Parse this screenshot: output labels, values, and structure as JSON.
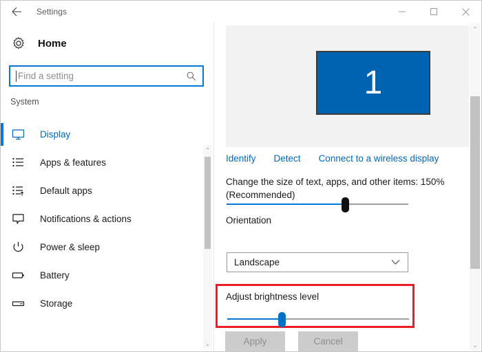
{
  "titlebar": {
    "back_icon": "back-arrow-icon",
    "title": "Settings",
    "minimize_label": "—",
    "maximize_label": "□",
    "close_label": "✕"
  },
  "sidebar": {
    "home_icon": "gear-icon",
    "home_label": "Home",
    "search": {
      "placeholder": "Find a setting",
      "value": "",
      "icon": "search-icon"
    },
    "group_label": "System",
    "items": [
      {
        "label": "Display",
        "icon": "monitor-icon",
        "selected": true
      },
      {
        "label": "Apps & features",
        "icon": "list-icon",
        "selected": false
      },
      {
        "label": "Default apps",
        "icon": "list-arrow-icon",
        "selected": false
      },
      {
        "label": "Notifications & actions",
        "icon": "speech-bubble-icon",
        "selected": false
      },
      {
        "label": "Power & sleep",
        "icon": "power-icon",
        "selected": false
      },
      {
        "label": "Battery",
        "icon": "battery-icon",
        "selected": false
      },
      {
        "label": "Storage",
        "icon": "drive-icon",
        "selected": false
      }
    ],
    "scrollbar": {
      "up_arrow": "⌃",
      "down_arrow": "⌄"
    }
  },
  "main": {
    "display_preview": {
      "monitor_number": "1"
    },
    "links": [
      {
        "label": "Identify"
      },
      {
        "label": "Detect"
      },
      {
        "label": "Connect to a wireless display"
      }
    ],
    "scale": {
      "label": "Change the size of text, apps, and other items: 150% (Recommended)",
      "value_percent": 150,
      "slider_position_percent": 65
    },
    "orientation": {
      "label": "Orientation",
      "selected": "Landscape",
      "chevron_icon": "chevron-down-icon"
    },
    "brightness": {
      "label": "Adjust brightness level",
      "slider_position_percent": 30,
      "highlight_color": "#ee1b24"
    },
    "buttons": {
      "apply": "Apply",
      "cancel": "Cancel"
    },
    "scrollbar": {
      "up_arrow": "⌃",
      "down_arrow": "⌄"
    }
  },
  "colors": {
    "accent": "#0078d7",
    "link": "#0067c0",
    "monitor": "#0063b1",
    "highlight": "#ee1b24"
  }
}
